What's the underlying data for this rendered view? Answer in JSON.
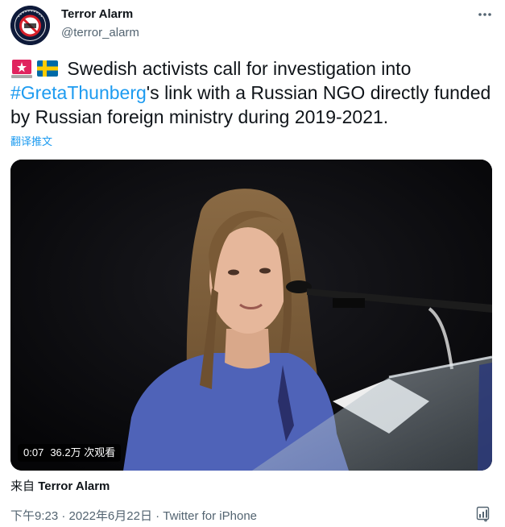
{
  "author": {
    "name": "Terror Alarm",
    "handle": "@terror_alarm"
  },
  "tweet": {
    "text_part1": " Swedish activists call for investigation into",
    "hashtag": "#GretaThunberg",
    "text_part2": "'s  link with a Russian NGO directly funded by Russian foreign ministry during 2019-2021.",
    "translate_label": "翻译推文"
  },
  "video": {
    "time": "0:07",
    "views": "36.2万 次观看"
  },
  "source": {
    "prefix": "来自",
    "name": "Terror Alarm"
  },
  "meta": {
    "time": "下午9:23",
    "separator1": " · ",
    "date": "2022年6月22日",
    "separator2": " · ",
    "client": "Twitter for iPhone"
  },
  "colors": {
    "link": "#1d9bf0",
    "secondary_text": "#536471",
    "primary_text": "#0f1419"
  },
  "icons": [
    "more-options-icon",
    "siren-emoji",
    "sweden-flag-emoji",
    "analytics-icon"
  ]
}
